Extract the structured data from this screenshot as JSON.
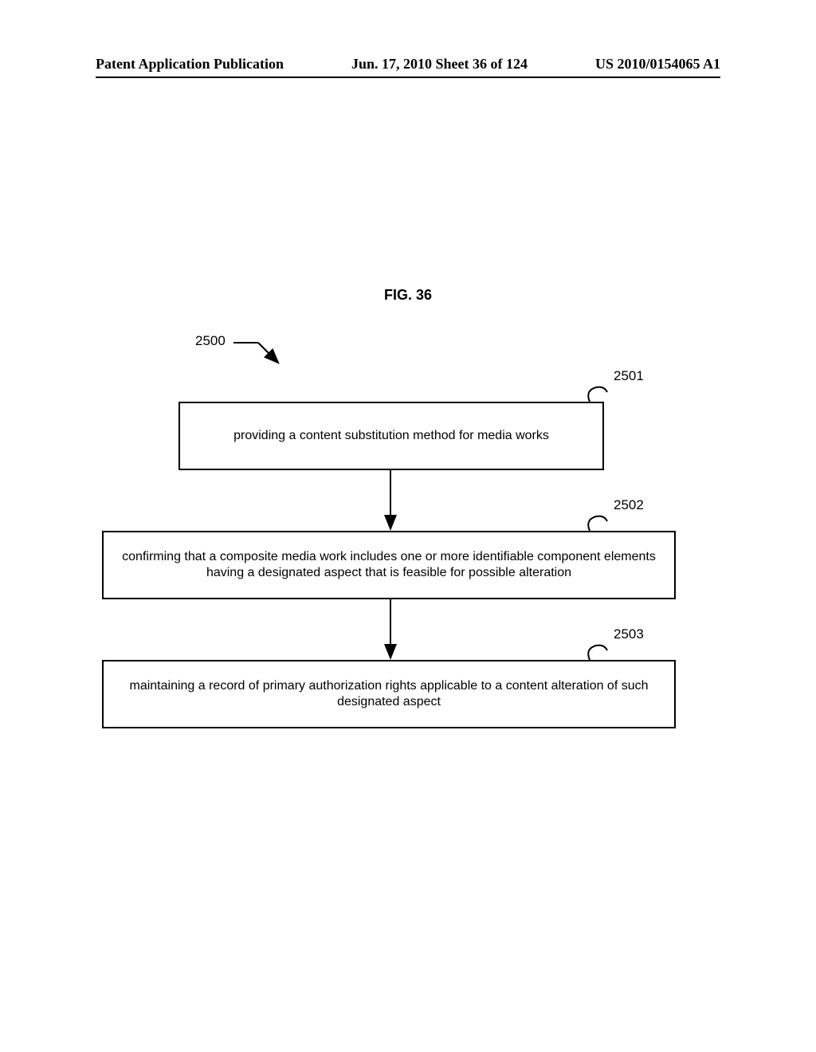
{
  "header": {
    "left": "Patent Application Publication",
    "center": "Jun. 17, 2010  Sheet 36 of 124",
    "right": "US 2010/0154065 A1"
  },
  "figure": {
    "title": "FIG. 36",
    "main_ref": "2500",
    "boxes": {
      "b1": {
        "ref": "2501",
        "text": "providing a content substitution method for media works"
      },
      "b2": {
        "ref": "2502",
        "text": "confirming that a composite media work includes one or more identifiable component elements having a designated aspect that is feasible for possible alteration"
      },
      "b3": {
        "ref": "2503",
        "text": "maintaining a record of primary authorization rights applicable to a content alteration of such designated aspect"
      }
    }
  },
  "chart_data": {
    "type": "diagram",
    "figure_number": "FIG. 36",
    "root_ref": "2500",
    "nodes": [
      {
        "id": "2501",
        "label": "providing a content substitution method for media works"
      },
      {
        "id": "2502",
        "label": "confirming that a composite media work includes one or more identifiable component elements having a designated aspect that is feasible for possible alteration"
      },
      {
        "id": "2503",
        "label": "maintaining a record of primary authorization rights applicable to a content alteration of such designated aspect"
      }
    ],
    "edges": [
      {
        "from": "2500",
        "to": "2501"
      },
      {
        "from": "2501",
        "to": "2502"
      },
      {
        "from": "2502",
        "to": "2503"
      }
    ]
  }
}
